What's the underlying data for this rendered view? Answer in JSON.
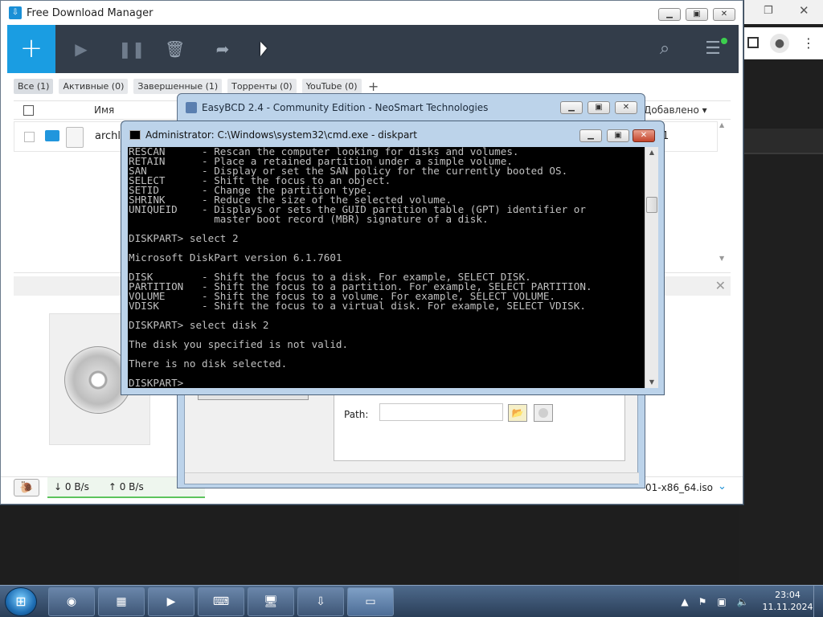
{
  "fdm": {
    "title": "Free Download Manager",
    "tabs": [
      {
        "label": "Все (1)"
      },
      {
        "label": "Активные (0)"
      },
      {
        "label": "Завершенные (1)"
      },
      {
        "label": "Торренты (0)"
      },
      {
        "label": "YouTube (0)"
      }
    ],
    "columns": {
      "name": "Имя",
      "added": "Добавлено ▾"
    },
    "row": {
      "name": "archli",
      "num": "1"
    },
    "status": {
      "down": "↓  0 B/s",
      "up": "↑  0 B/s",
      "filename_tail": "01-x86_64.iso"
    }
  },
  "easybcd": {
    "title": "EasyBCD 2.4 - Community Edition - NeoSmart Technologies",
    "path_label": "Path:"
  },
  "cmd": {
    "title": "Administrator: C:\\Windows\\system32\\cmd.exe - diskpart",
    "lines": [
      "RESCAN      - Rescan the computer looking for disks and volumes.",
      "RETAIN      - Place a retained partition under a simple volume.",
      "SAN         - Display or set the SAN policy for the currently booted OS.",
      "SELECT      - Shift the focus to an object.",
      "SETID       - Change the partition type.",
      "SHRINK      - Reduce the size of the selected volume.",
      "UNIQUEID    - Displays or sets the GUID partition table (GPT) identifier or",
      "              master boot record (MBR) signature of a disk.",
      "",
      "DISKPART> select 2",
      "",
      "Microsoft DiskPart version 6.1.7601",
      "",
      "DISK        - Shift the focus to a disk. For example, SELECT DISK.",
      "PARTITION   - Shift the focus to a partition. For example, SELECT PARTITION.",
      "VOLUME      - Shift the focus to a volume. For example, SELECT VOLUME.",
      "VDISK       - Shift the focus to a virtual disk. For example, SELECT VDISK.",
      "",
      "DISKPART> select disk 2",
      "",
      "The disk you specified is not valid.",
      "",
      "There is no disk selected.",
      "",
      "DISKPART>"
    ]
  },
  "taskbar": {
    "clock_time": "23:04",
    "clock_date": "11.11.2024"
  },
  "colors": {
    "fdm_toolbar": "#333d4a",
    "fdm_accent": "#1a9de2",
    "console_bg": "#000000",
    "console_fg": "#c0c0c0"
  }
}
